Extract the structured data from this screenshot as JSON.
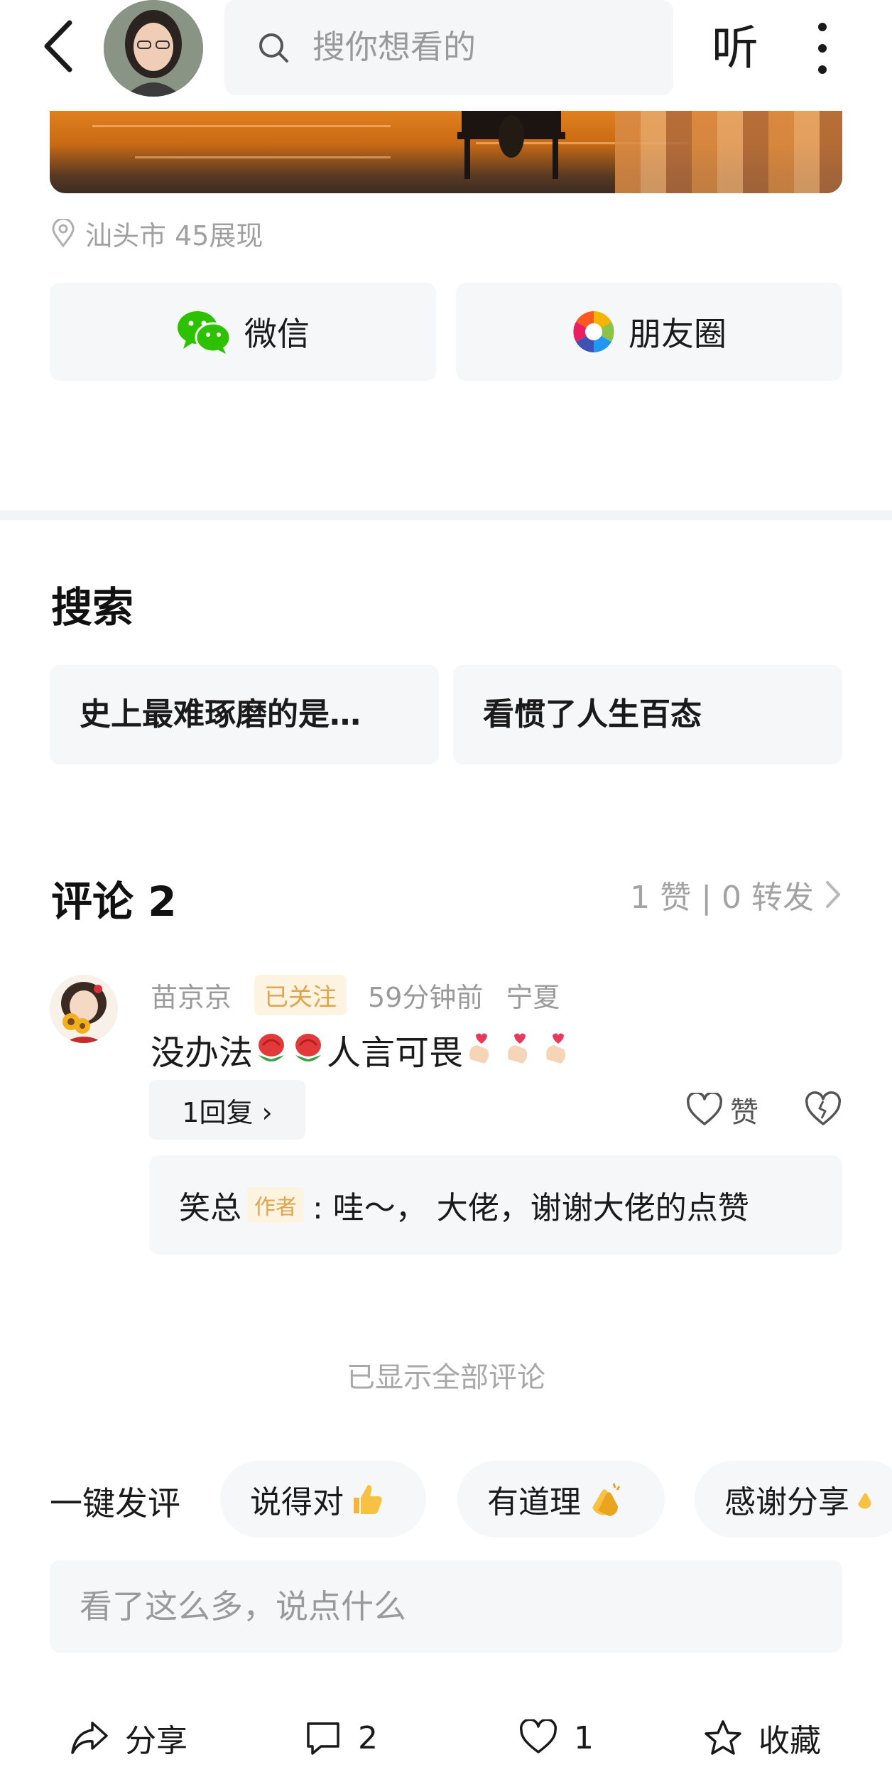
{
  "header": {
    "search_placeholder": "搜你想看的",
    "listen_label": "听"
  },
  "post": {
    "location": "汕头市 45展现"
  },
  "share": {
    "wechat_label": "微信",
    "moments_label": "朋友圈"
  },
  "search_section": {
    "title": "搜索",
    "items": [
      "史上最难琢磨的是…",
      "看惯了人生百态"
    ]
  },
  "comments": {
    "title": "评论 2",
    "stats": "1 赞 | 0 转发",
    "items": [
      {
        "author": "苗京京",
        "badge": "已关注",
        "time": "59分钟前",
        "region": "宁夏",
        "text_a": "没办法",
        "text_b": "人言可畏",
        "reply_count": "1回复 ›",
        "like_label": "赞",
        "sub_reply": {
          "author": "笑总",
          "tag": "作者",
          "text": ": 哇～， 大佬，谢谢大佬的点赞"
        }
      }
    ],
    "all_shown": "已显示全部评论"
  },
  "quick_comment": {
    "label": "一键发评",
    "chips": [
      "说得对",
      "有道理",
      "感谢分享"
    ]
  },
  "comment_input": {
    "placeholder": "看了这么多，说点什么"
  },
  "bottom_bar": {
    "share_label": "分享",
    "comment_count": "2",
    "like_count": "1",
    "favorite_label": "收藏"
  },
  "colors": {
    "accent_badge": "#e0a44c",
    "wechat_green": "#2dc100",
    "muted_text": "#a0a0a0"
  }
}
